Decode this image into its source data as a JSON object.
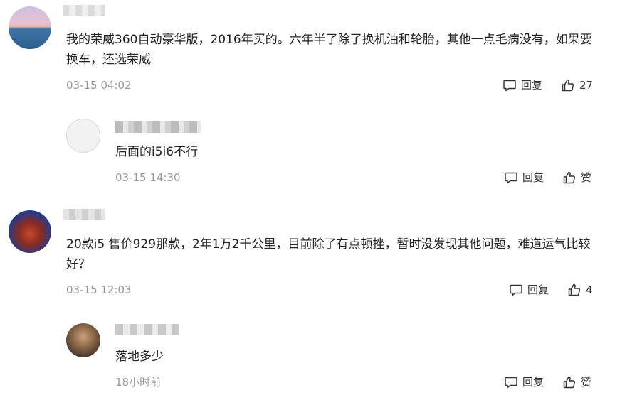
{
  "comments": [
    {
      "text": "我的荣威360自动豪华版，2016年买的。六年半了除了换机油和轮胎，其他一点毛病没有，如果要换车，还选荣威",
      "time": "03-15 04:02",
      "reply_label": "回复",
      "like_label": "27"
    },
    {
      "text": "20款i5 售价929那款，2年1万2千公里，目前除了有点顿挫，暂时没发现其他问题，难道运气比较好？",
      "time": "03-15 12:03",
      "reply_label": "回复",
      "like_label": "4"
    }
  ],
  "replies": [
    {
      "text": "后面的i5i6不行",
      "time": "03-15 14:30",
      "reply_label": "回复",
      "like_label": "赞"
    },
    {
      "text": "落地多少",
      "time": "18小时前",
      "reply_label": "回复",
      "like_label": "赞"
    }
  ]
}
